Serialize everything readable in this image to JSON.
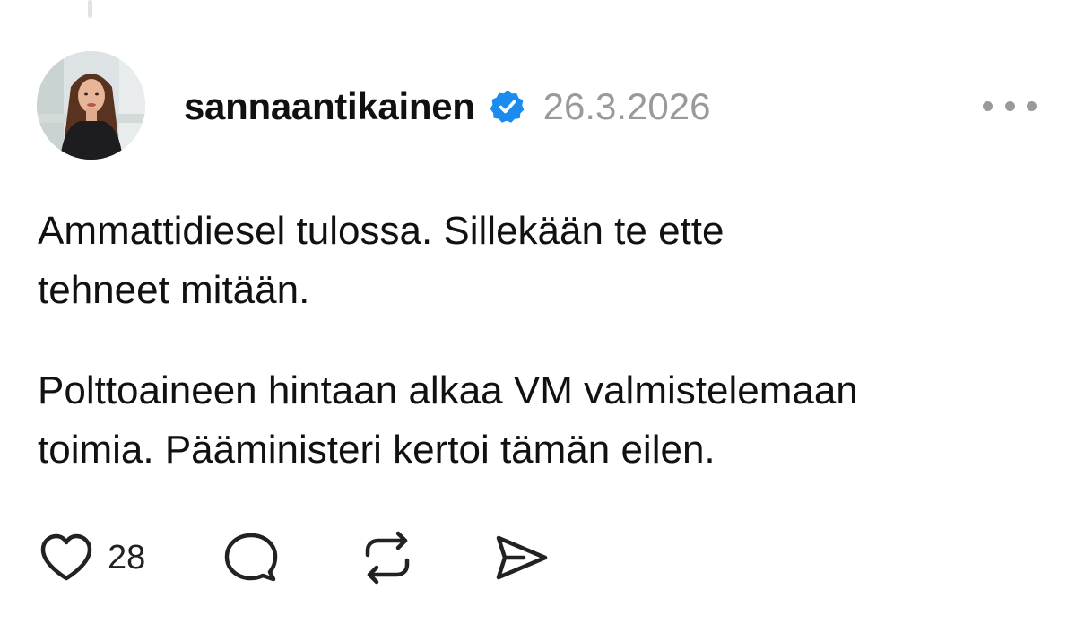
{
  "post": {
    "author": {
      "username": "sannaantikainen",
      "verified": true,
      "avatar_icon": "profile-photo"
    },
    "date": "26.3.2026",
    "more_icon": "more-options-icon",
    "paragraphs": [
      {
        "lines": [
          "Ammattidiesel tulossa. Sillekään te ette",
          "tehneet mitään."
        ]
      },
      {
        "lines": [
          "Polttoaineen hintaan alkaa VM valmistelemaan",
          "toimia. Pääministeri kertoi tämän eilen."
        ]
      }
    ],
    "actions": {
      "like": {
        "icon": "heart-icon",
        "count": "28"
      },
      "comment": {
        "icon": "comment-icon"
      },
      "repost": {
        "icon": "repost-icon"
      },
      "share": {
        "icon": "share-icon"
      }
    }
  },
  "colors": {
    "text": "#111111",
    "muted": "#9a9a9a",
    "verified_badge": "#1a8cf0",
    "thread_line": "#e2e2e2"
  }
}
